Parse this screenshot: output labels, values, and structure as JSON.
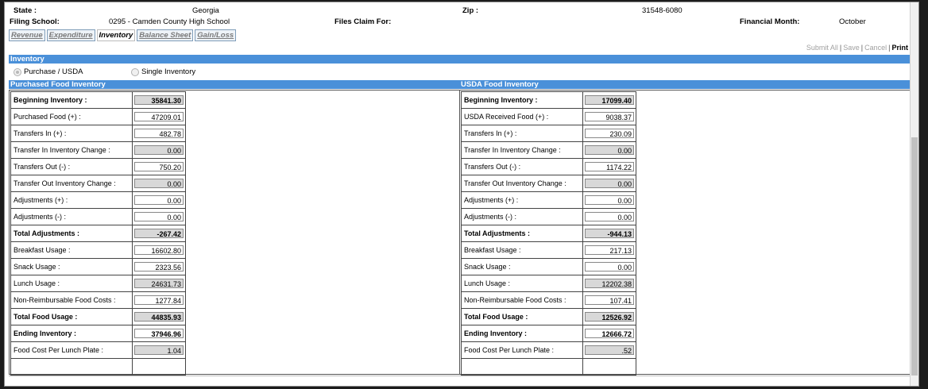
{
  "header": {
    "state_label": "State :",
    "state_value": "Georgia",
    "zip_label": "Zip :",
    "zip_value": "31548-6080",
    "filing_school_label": "Filing School:",
    "filing_school_value": "0295 - Camden County High School",
    "files_claim_label": "Files Claim For:",
    "financial_month_label": "Financial Month:",
    "financial_month_value": "October"
  },
  "tabs": [
    {
      "label": "Revenue"
    },
    {
      "label": "Expenditure"
    },
    {
      "label": "Inventory"
    },
    {
      "label": "Balance Sheet"
    },
    {
      "label": "Gain/Loss"
    }
  ],
  "actions": {
    "submit_all": "Submit All",
    "save": "Save",
    "cancel": "Cancel",
    "print": "Print",
    "separator": "|"
  },
  "section_title": "Inventory",
  "inventory_type": {
    "option_purchase_usda": "Purchase / USDA",
    "option_single": "Single Inventory",
    "selected": "Purchase / USDA"
  },
  "purchased": {
    "title": "Purchased Food Inventory",
    "rows": [
      {
        "label": "Beginning Inventory :",
        "value": "35841.30",
        "readonly": true,
        "bold": true
      },
      {
        "label": "Purchased Food (+) :",
        "value": "47209.01",
        "readonly": false,
        "bold": false
      },
      {
        "label": "Transfers In (+) :",
        "value": "482.78",
        "readonly": false,
        "bold": false
      },
      {
        "label": "Transfer In Inventory Change :",
        "value": "0.00",
        "readonly": true,
        "bold": false
      },
      {
        "label": "Transfers Out (-) :",
        "value": "750.20",
        "readonly": false,
        "bold": false
      },
      {
        "label": "Transfer Out Inventory Change :",
        "value": "0.00",
        "readonly": true,
        "bold": false
      },
      {
        "label": "Adjustments (+) :",
        "value": "0.00",
        "readonly": false,
        "bold": false
      },
      {
        "label": "Adjustments (-) :",
        "value": "0.00",
        "readonly": false,
        "bold": false
      },
      {
        "label": "Total Adjustments :",
        "value": "-267.42",
        "readonly": true,
        "bold": true
      },
      {
        "label": "Breakfast Usage :",
        "value": "16602.80",
        "readonly": false,
        "bold": false
      },
      {
        "label": "Snack Usage :",
        "value": "2323.56",
        "readonly": false,
        "bold": false
      },
      {
        "label": "Lunch Usage :",
        "value": "24631.73",
        "readonly": true,
        "bold": false
      },
      {
        "label": "Non-Reimbursable Food Costs :",
        "value": "1277.84",
        "readonly": false,
        "bold": false
      },
      {
        "label": "Total Food Usage :",
        "value": "44835.93",
        "readonly": true,
        "bold": true
      },
      {
        "label": "Ending Inventory :",
        "value": "37946.96",
        "readonly": false,
        "bold": true
      },
      {
        "label": "Food Cost Per Lunch Plate :",
        "value": "1.04",
        "readonly": true,
        "bold": false
      }
    ]
  },
  "usda": {
    "title": "USDA Food Inventory",
    "rows": [
      {
        "label": "Beginning Inventory :",
        "value": "17099.40",
        "readonly": true,
        "bold": true
      },
      {
        "label": "USDA Received Food (+) :",
        "value": "9038.37",
        "readonly": false,
        "bold": false
      },
      {
        "label": "Transfers In (+) :",
        "value": "230.09",
        "readonly": false,
        "bold": false
      },
      {
        "label": "Transfer In Inventory Change :",
        "value": "0.00",
        "readonly": true,
        "bold": false
      },
      {
        "label": "Transfers Out (-) :",
        "value": "1174.22",
        "readonly": false,
        "bold": false
      },
      {
        "label": "Transfer Out Inventory Change :",
        "value": "0.00",
        "readonly": true,
        "bold": false
      },
      {
        "label": "Adjustments (+) :",
        "value": "0.00",
        "readonly": false,
        "bold": false
      },
      {
        "label": "Adjustments (-) :",
        "value": "0.00",
        "readonly": false,
        "bold": false
      },
      {
        "label": "Total Adjustments :",
        "value": "-944.13",
        "readonly": true,
        "bold": true
      },
      {
        "label": "Breakfast Usage :",
        "value": "217.13",
        "readonly": false,
        "bold": false
      },
      {
        "label": "Snack Usage :",
        "value": "0.00",
        "readonly": false,
        "bold": false
      },
      {
        "label": "Lunch Usage :",
        "value": "12202.38",
        "readonly": true,
        "bold": false
      },
      {
        "label": "Non-Reimbursable Food Costs :",
        "value": "107.41",
        "readonly": false,
        "bold": false
      },
      {
        "label": "Total Food Usage :",
        "value": "12526.92",
        "readonly": true,
        "bold": true
      },
      {
        "label": "Ending Inventory :",
        "value": "12666.72",
        "readonly": false,
        "bold": true
      },
      {
        "label": "Food Cost Per Lunch Plate :",
        "value": ".52",
        "readonly": true,
        "bold": false
      }
    ]
  }
}
